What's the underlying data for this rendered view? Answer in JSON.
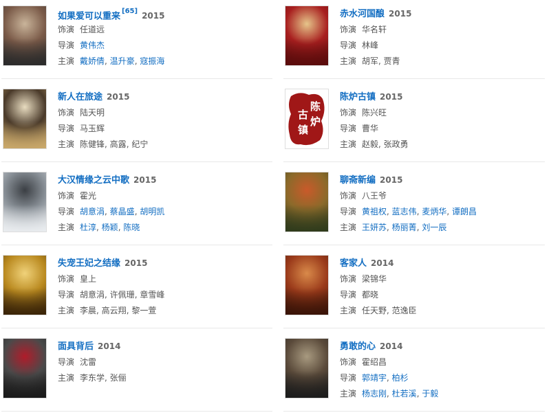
{
  "cards": [
    {
      "title": "如果爱可以重来",
      "ref": "[65]",
      "year": "2015",
      "role_label": "饰演",
      "role": "任道远",
      "director_label": "导演",
      "directors": [
        {
          "name": "黄伟杰",
          "link": true
        }
      ],
      "cast_label": "主演",
      "cast": [
        {
          "name": "戴娇倩",
          "link": true
        },
        {
          "name": "温升豪",
          "link": true
        },
        {
          "name": "寇振海",
          "link": true
        }
      ],
      "colors": [
        "#2b2b2b",
        "#7a5a48",
        "#c9b49a"
      ]
    },
    {
      "title": "赤水河国酿",
      "year": "2015",
      "role_label": "饰演",
      "role": "华名轩",
      "director_label": "导演",
      "directors": [
        {
          "name": "林峰",
          "link": false
        }
      ],
      "cast_label": "主演",
      "cast": [
        {
          "name": "胡军",
          "link": false
        },
        {
          "name": "贾青",
          "link": false
        }
      ],
      "colors": [
        "#5a0c0c",
        "#a81f1f",
        "#e6c58a"
      ]
    },
    {
      "title": "新人在旅途",
      "year": "2015",
      "role_label": "饰演",
      "role": "陆天明",
      "director_label": "导演",
      "directors": [
        {
          "name": "马玉辉",
          "link": false
        }
      ],
      "cast_label": "主演",
      "cast": [
        {
          "name": "陈健锋",
          "link": false
        },
        {
          "name": "高露",
          "link": false
        },
        {
          "name": "纪宁",
          "link": false
        }
      ],
      "colors": [
        "#c9a86a",
        "#4a3a2a",
        "#e8dcc0"
      ]
    },
    {
      "title": "陈炉古镇",
      "year": "2015",
      "role_label": "饰演",
      "role": "陈兴旺",
      "director_label": "导演",
      "directors": [
        {
          "name": "曹华",
          "link": false
        }
      ],
      "cast_label": "主演",
      "cast": [
        {
          "name": "赵毅",
          "link": false
        },
        {
          "name": "张政勇",
          "link": false
        }
      ],
      "colors": [
        "#ffffff",
        "#a01717",
        "#a01717"
      ],
      "poster_text": "陈炉古镇"
    },
    {
      "title": "大汉情缘之云中歌",
      "year": "2015",
      "role_label": "饰演",
      "role": "霍光",
      "director_label": "导演",
      "directors": [
        {
          "name": "胡意涓",
          "link": true
        },
        {
          "name": "蔡晶盛",
          "link": true
        },
        {
          "name": "胡明凯",
          "link": true
        }
      ],
      "cast_label": "主演",
      "cast": [
        {
          "name": "杜淳",
          "link": true
        },
        {
          "name": "杨颖",
          "link": true
        },
        {
          "name": "陈晓",
          "link": true
        }
      ],
      "colors": [
        "#e9ecef",
        "#8a9198",
        "#3b3f44"
      ]
    },
    {
      "title": "聊斋新编",
      "year": "2015",
      "role_label": "饰演",
      "role": "八王爷",
      "director_label": "导演",
      "directors": [
        {
          "name": "黄祖权",
          "link": true
        },
        {
          "name": "蓝志伟",
          "link": true
        },
        {
          "name": "麦炳华",
          "link": true
        },
        {
          "name": "谭朗昌",
          "link": true
        }
      ],
      "cast_label": "主演",
      "cast": [
        {
          "name": "王妍苏",
          "link": true
        },
        {
          "name": "杨丽菁",
          "link": true
        },
        {
          "name": "刘一辰",
          "link": true
        }
      ],
      "colors": [
        "#2f3b1c",
        "#8b6a2a",
        "#c95a2a"
      ]
    },
    {
      "title": "失宠王妃之结缘",
      "year": "2015",
      "role_label": "饰演",
      "role": "皇上",
      "director_label": "导演",
      "directors": [
        {
          "name": "胡意涓",
          "link": false
        },
        {
          "name": "许佩珊",
          "link": false
        },
        {
          "name": "章雪峰",
          "link": false
        }
      ],
      "cast_label": "主演",
      "cast": [
        {
          "name": "李晨",
          "link": false
        },
        {
          "name": "高云翔",
          "link": false
        },
        {
          "name": "黎一萱",
          "link": false
        }
      ],
      "colors": [
        "#3a2408",
        "#b9891f",
        "#f0d27a"
      ]
    },
    {
      "title": "客家人",
      "year": "2014",
      "role_label": "饰演",
      "role": "梁锦华",
      "director_label": "导演",
      "directors": [
        {
          "name": "都晓",
          "link": false
        }
      ],
      "cast_label": "主演",
      "cast": [
        {
          "name": "任天野",
          "link": false
        },
        {
          "name": "范逸臣",
          "link": false
        }
      ],
      "colors": [
        "#3a1408",
        "#9a3a1a",
        "#d98a4a"
      ]
    },
    {
      "title": "面具背后",
      "year": "2014",
      "role_label": "",
      "role": "",
      "director_label": "导演",
      "directors": [
        {
          "name": "沈雷",
          "link": false
        }
      ],
      "cast_label": "主演",
      "cast": [
        {
          "name": "李东学",
          "link": false
        },
        {
          "name": "张俪",
          "link": false
        }
      ],
      "colors": [
        "#1a1a1a",
        "#4a4a4a",
        "#b01c2a"
      ]
    },
    {
      "title": "勇敢的心",
      "year": "2014",
      "role_label": "饰演",
      "role": "霍绍昌",
      "director_label": "导演",
      "directors": [
        {
          "name": "郭靖宇",
          "link": true
        },
        {
          "name": "柏杉",
          "link": true
        }
      ],
      "cast_label": "主演",
      "cast": [
        {
          "name": "杨志刚",
          "link": true
        },
        {
          "name": "杜若溪",
          "link": true
        },
        {
          "name": "于毅",
          "link": true
        }
      ],
      "colors": [
        "#1c1c1c",
        "#5a4a3a",
        "#a89a80"
      ]
    }
  ]
}
